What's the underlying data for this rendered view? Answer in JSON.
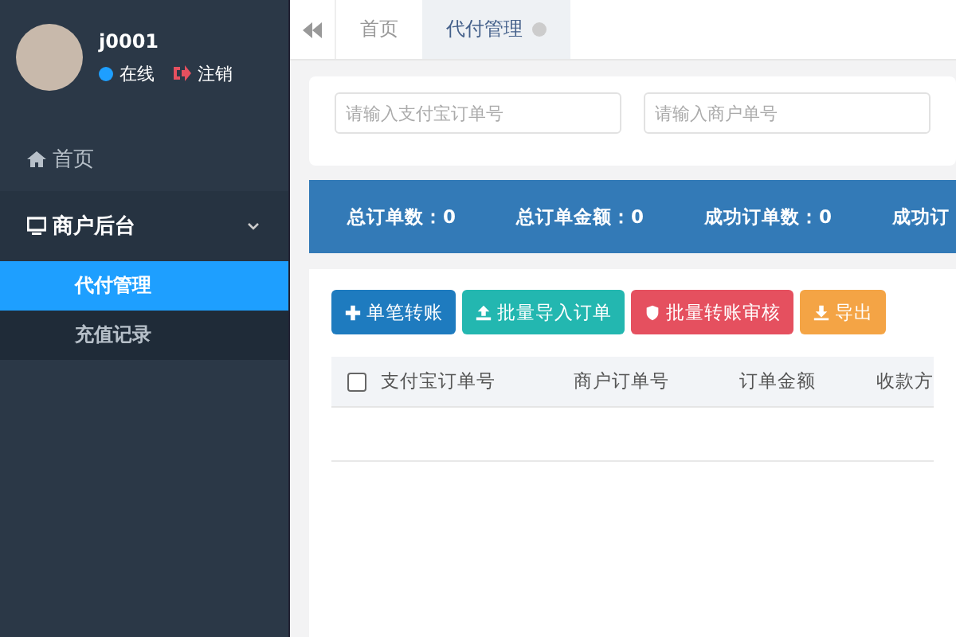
{
  "user": {
    "name": "j0001",
    "status": "在线",
    "logout": "注销"
  },
  "sidebar": {
    "items": [
      {
        "label": "首页",
        "selected": false
      },
      {
        "label": "商户后台",
        "expanded": true,
        "selected": false,
        "children": [
          {
            "label": "代付管理",
            "selected": true
          },
          {
            "label": "充值记录",
            "selected": false
          }
        ]
      }
    ]
  },
  "tabs": [
    {
      "label": "首页",
      "selected": false,
      "closable": false
    },
    {
      "label": "代付管理",
      "selected": true,
      "closable": true
    }
  ],
  "search": [
    {
      "placeholder": "请输入支付宝订单号"
    },
    {
      "placeholder": "请输入商户单号"
    }
  ],
  "stats": [
    "总订单数：0",
    "总订单金额：0",
    "成功订单数：0",
    "成功订"
  ],
  "buttons": [
    {
      "label": "单笔转账",
      "kind": "add",
      "color": "#1e7bbf"
    },
    {
      "label": "批量导入订单",
      "kind": "upload",
      "color": "#23b7b0"
    },
    {
      "label": "批量转账审核",
      "kind": "shield",
      "color": "#e5505f"
    },
    {
      "label": "导出",
      "kind": "download",
      "color": "#f4a445"
    }
  ],
  "table": {
    "select_all": false,
    "columns": [
      "支付宝订单号",
      "商户订单号",
      "订单金额",
      "收款方"
    ]
  }
}
